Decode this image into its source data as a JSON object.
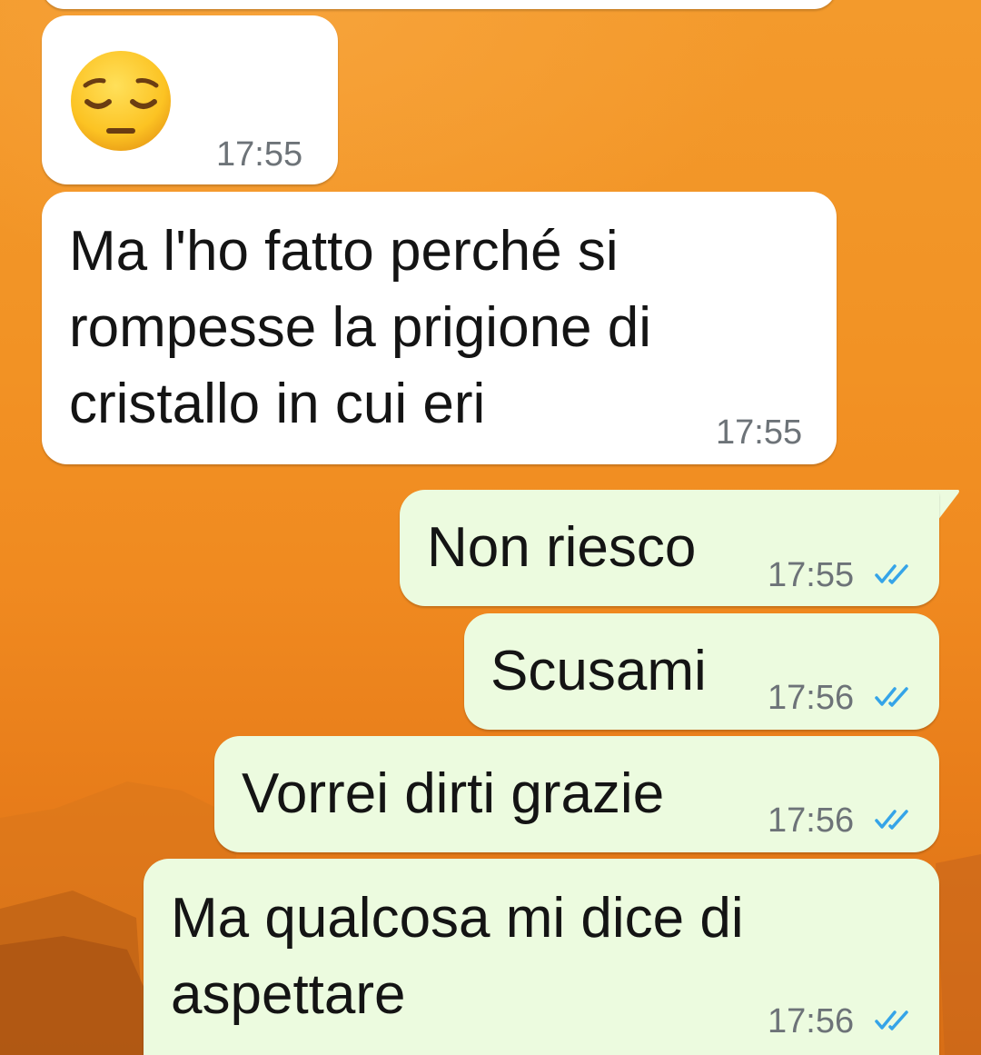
{
  "colors": {
    "incoming_bubble": "#ffffff",
    "outgoing_bubble": "#ecfbdf",
    "read_ticks": "#35a4e8",
    "timestamp": "#6d7378",
    "background": "#f29224"
  },
  "messages": [
    {
      "direction": "incoming",
      "type": "emoji",
      "emoji_icon": "pensive-face-icon",
      "time": "17:55"
    },
    {
      "direction": "incoming",
      "type": "text",
      "lines": [
        "Ma l'ho fatto perché si",
        "rompesse la prigione di",
        "cristallo in cui eri"
      ],
      "time": "17:55"
    },
    {
      "direction": "outgoing",
      "type": "text",
      "lines": [
        "Non riesco"
      ],
      "time": "17:55",
      "status": "read"
    },
    {
      "direction": "outgoing",
      "type": "text",
      "lines": [
        "Scusami"
      ],
      "time": "17:56",
      "status": "read"
    },
    {
      "direction": "outgoing",
      "type": "text",
      "lines": [
        "Vorrei dirti grazie"
      ],
      "time": "17:56",
      "status": "read"
    },
    {
      "direction": "outgoing",
      "type": "text",
      "lines": [
        "Ma qualcosa mi dice di",
        "aspettare"
      ],
      "time": "17:56",
      "status": "read"
    }
  ]
}
